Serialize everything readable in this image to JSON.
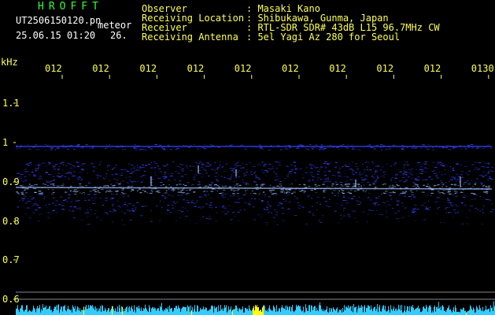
{
  "header": {
    "program": "HROFFT",
    "filename": "UT2506150120.pn",
    "mode_label": "meteor",
    "datetime": "25.06.15 01:20",
    "frame_number": "26.",
    "info": [
      {
        "label": "Observer",
        "value": ": Masaki Kano"
      },
      {
        "label": "Receiving Location",
        "value": ": Shibukawa, Gunma, Japan"
      },
      {
        "label": "Receiver",
        "value": ": RTL-SDR SDR# 43dB L15 96.7MHz CW"
      },
      {
        "label": "Receiving Antenna",
        "value": ": 5el Yagi Az 280 for Seoul"
      }
    ]
  },
  "spectrogram": {
    "frequency_unit": "kHz",
    "y_ticks": [
      "1.1",
      "1",
      "0.9",
      "0.8",
      "0.7",
      "0.6"
    ],
    "time_ticks": [
      "012",
      "012",
      "012",
      "012",
      "012",
      "012",
      "012",
      "012",
      "012",
      "0130"
    ],
    "colors": {
      "signal": "#3344ff",
      "bright": "#99bbff",
      "axis": "#ffff55",
      "gridline": "#888888",
      "spectrum": "#33ccff",
      "spectrum_peak": "#ffff00"
    }
  }
}
